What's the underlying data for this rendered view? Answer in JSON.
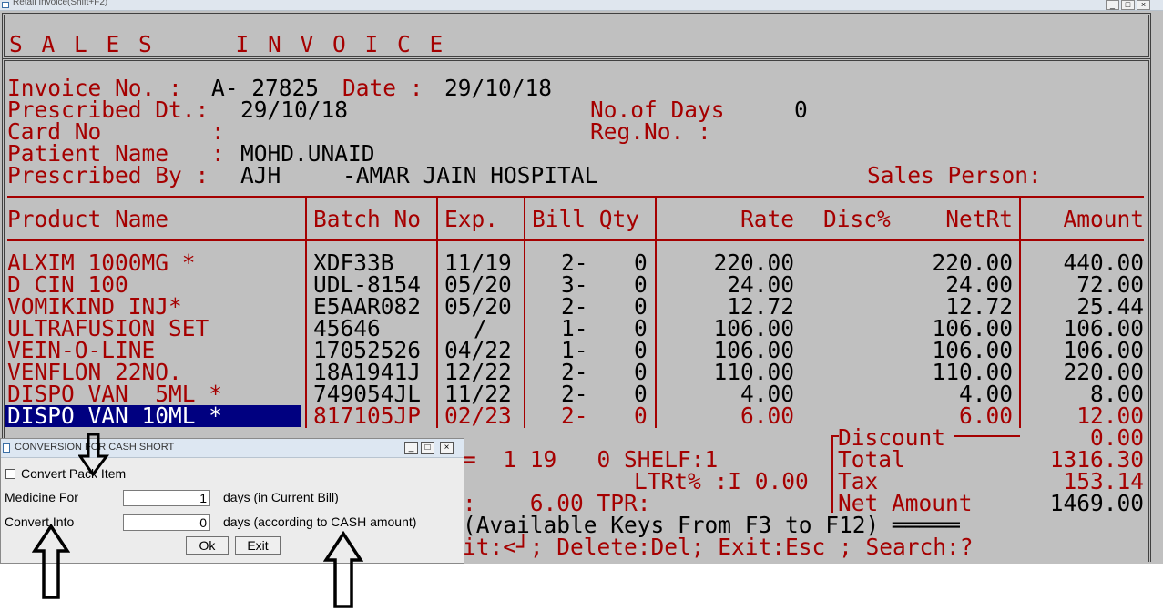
{
  "window": {
    "title": "Retail Invoice(Shift+F2)"
  },
  "header": {
    "title": "S A L E S     I N V O I C E"
  },
  "invoice": {
    "no_label": "Invoice No. :",
    "no_value": "A- 27825",
    "date_label": "Date :",
    "date_value": "29/10/18",
    "prescribed_dt_label": "Prescribed Dt.:",
    "prescribed_dt_value": "29/10/18",
    "days_label": "No.of Days",
    "days_value": "0",
    "card_label": "Card No",
    "card_colon": ":",
    "reg_label": "Reg.No. :",
    "patient_label": "Patient Name",
    "patient_colon": ":",
    "patient_value": "MOHD.UNAID",
    "prescribed_by_label": "Prescribed By :",
    "prescribed_by_value": "AJH",
    "hospital": "-AMAR JAIN HOSPITAL",
    "sales_person_label": "Sales Person:"
  },
  "table": {
    "headers": {
      "product": "Product Name",
      "batch": "Batch No",
      "exp": "Exp.",
      "billqty": "Bill Qty",
      "rate": "Rate",
      "disc": "Disc%",
      "netrt": "NetRt",
      "amount": "Amount"
    },
    "rows": [
      {
        "product": "ALXIM 1000MG *",
        "batch": "XDF33B",
        "exp": "11/19",
        "bill": "2-",
        "qty": "0",
        "rate": "220.00",
        "netrt": "220.00",
        "amount": "440.00"
      },
      {
        "product": "D CIN 100",
        "batch": "UDL-8154",
        "exp": "05/20",
        "bill": "3-",
        "qty": "0",
        "rate": "24.00",
        "netrt": "24.00",
        "amount": "72.00"
      },
      {
        "product": "VOMIKIND INJ*",
        "batch": "E5AAR082",
        "exp": "05/20",
        "bill": "2-",
        "qty": "0",
        "rate": "12.72",
        "netrt": "12.72",
        "amount": "25.44"
      },
      {
        "product": "ULTRAFUSION SET",
        "batch": "45646",
        "exp": "/",
        "bill": "1-",
        "qty": "0",
        "rate": "106.00",
        "netrt": "106.00",
        "amount": "106.00"
      },
      {
        "product": "VEIN-O-LINE",
        "batch": "17052526",
        "exp": "04/22",
        "bill": "1-",
        "qty": "0",
        "rate": "106.00",
        "netrt": "106.00",
        "amount": "106.00"
      },
      {
        "product": "VENFLON 22NO.",
        "batch": "18A1941J",
        "exp": "12/22",
        "bill": "2-",
        "qty": "0",
        "rate": "110.00",
        "netrt": "110.00",
        "amount": "220.00"
      },
      {
        "product": "DISPO VAN  5ML *",
        "batch": "749054JL",
        "exp": "11/22",
        "bill": "2-",
        "qty": "0",
        "rate": "4.00",
        "netrt": "4.00",
        "amount": "8.00"
      },
      {
        "product": "DISPO VAN 10ML *",
        "batch": "817105JP",
        "exp": "02/23",
        "bill": "2-",
        "qty": "0",
        "rate": "6.00",
        "netrt": "6.00",
        "amount": "12.00"
      }
    ]
  },
  "footer": {
    "stock_line": "=  1 19   0 SHELF:1",
    "ltrt_line": "LTRt% :I 0.00",
    "tpr_line": ":    6.00 TPR:",
    "keys_line": "(Available Keys From F3 to F12) ═════",
    "help_line": "it:<┘; Delete:Del; Exit:Esc ; Search:?"
  },
  "totals": {
    "discount_label": "Discount",
    "discount_value": "0.00",
    "total_label": "Total",
    "total_value": "1316.30",
    "tax_label": "Tax",
    "tax_value": "153.14",
    "net_label": "Net Amount",
    "net_value": "1469.00"
  },
  "dialog": {
    "title": "CONVERSION FOR CASH SHORT",
    "convert_pack_label": "Convert Pack Item",
    "medicine_for_label": "Medicine For",
    "medicine_for_value": "1",
    "medicine_for_suffix": "days (in Current Bill)",
    "convert_into_label": "Convert Into",
    "convert_into_value": "0",
    "convert_into_suffix": "days (according to CASH amount)",
    "ok_label": "Ok",
    "exit_label": "Exit"
  },
  "icons": {
    "arrows": "up-arrow-icon"
  }
}
